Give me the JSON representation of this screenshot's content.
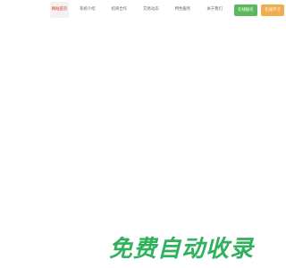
{
  "nav": {
    "items": [
      {
        "label": "网站首页",
        "active": true
      },
      {
        "label": "系统介绍",
        "active": false
      },
      {
        "label": "招商合作",
        "active": false
      },
      {
        "label": "交易动态",
        "active": false
      },
      {
        "label": "特色服务",
        "active": false
      },
      {
        "label": "关于我们",
        "active": false
      }
    ],
    "buttons": [
      {
        "label": "在线报名",
        "color": "#5cb85c"
      },
      {
        "label": "在线学习",
        "color": "#f0ad4e"
      }
    ],
    "active_color": "#e2231a"
  },
  "watermark": {
    "text": "免费自动收录",
    "color": "#2fb15e"
  }
}
